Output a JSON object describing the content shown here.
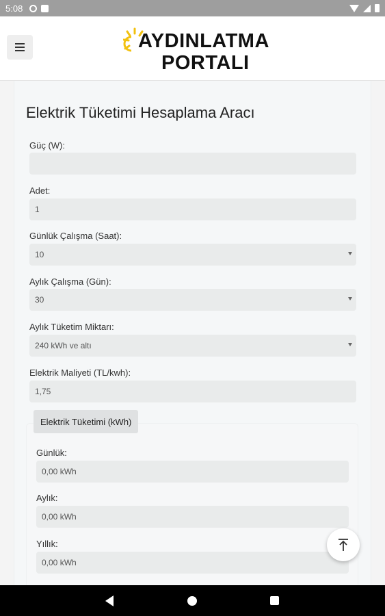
{
  "status_bar": {
    "time": "5:08"
  },
  "header": {
    "menu_icon": "hamburger-icon",
    "logo_line1": "AYDINLATMA",
    "logo_line2": "PORTALI",
    "logo_sun_color": "#f2c10f"
  },
  "main": {
    "title": "Elektrik Tüketimi Hesaplama Aracı",
    "fields": {
      "power": {
        "label": "Güç (W):",
        "value": ""
      },
      "count": {
        "label": "Adet:",
        "value": "1"
      },
      "daily_hours": {
        "label": "Günlük Çalışma (Saat):",
        "value": "10"
      },
      "monthly_days": {
        "label": "Aylık Çalışma (Gün):",
        "value": "30"
      },
      "monthly_consumption": {
        "label": "Aylık Tüketim Miktarı:",
        "value": "240 kWh ve altı"
      },
      "cost": {
        "label": "Elektrik Maliyeti (TL/kwh):",
        "value": "1,75"
      }
    },
    "results": {
      "tag": "Elektrik Tüketimi (kWh)",
      "daily": {
        "label": "Günlük:",
        "value": "0,00 kWh"
      },
      "monthly": {
        "label": "Aylık:",
        "value": "0,00 kWh"
      },
      "yearly": {
        "label": "Yıllık:",
        "value": "0,00 kWh"
      }
    }
  },
  "fab_icon": "scroll-to-top-icon"
}
